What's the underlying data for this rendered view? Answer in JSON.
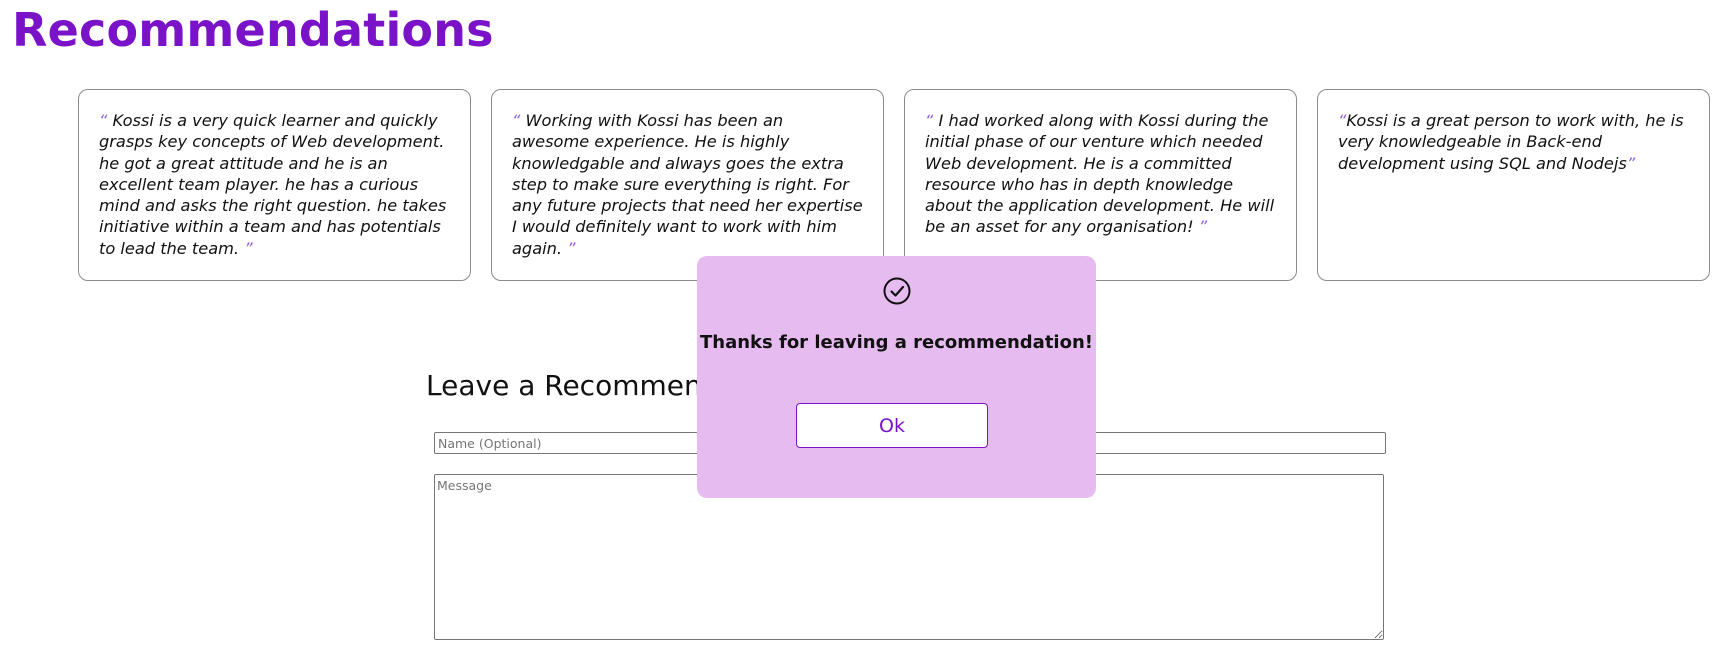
{
  "page": {
    "title": "Recommendations"
  },
  "recommendations": [
    {
      "open_quote": "“",
      "text": " Kossi is a very quick learner and quickly grasps key concepts of Web development. he got a great attitude and he is an excellent team player. he has a curious mind and asks the right question. he takes initiative within a team and has potentials to lead the team. ",
      "close_quote": "”"
    },
    {
      "open_quote": "“",
      "text": " Working with Kossi has been an awesome experience. He is highly knowledgable and always goes the extra step to make sure everything is right. For any future projects that need her expertise I would definitely want to work with him again. ",
      "close_quote": "”"
    },
    {
      "open_quote": "“",
      "text": " I had worked along with Kossi during the initial phase of our venture which needed Web development. He is a committed resource who has in depth knowledge about the application development. He will be an asset for any organisation! ",
      "close_quote": "”"
    },
    {
      "open_quote": "“",
      "text": "Kossi is a great person to work with, he is very knowledgeable in Back-end development using SQL and Nodejs",
      "close_quote": "”"
    }
  ],
  "form": {
    "heading": "Leave a Recommendation",
    "name_placeholder": "Name (Optional)",
    "name_value": "",
    "message_placeholder": "Message",
    "message_value": ""
  },
  "modal": {
    "icon": "check-circle-icon",
    "message": "Thanks for leaving a recommendation!",
    "ok_label": "Ok"
  },
  "colors": {
    "accent": "#7a12c8",
    "quote_mark": "#8f5ed6",
    "modal_background": "#e6bcf0",
    "card_border": "#8c8c8c"
  }
}
